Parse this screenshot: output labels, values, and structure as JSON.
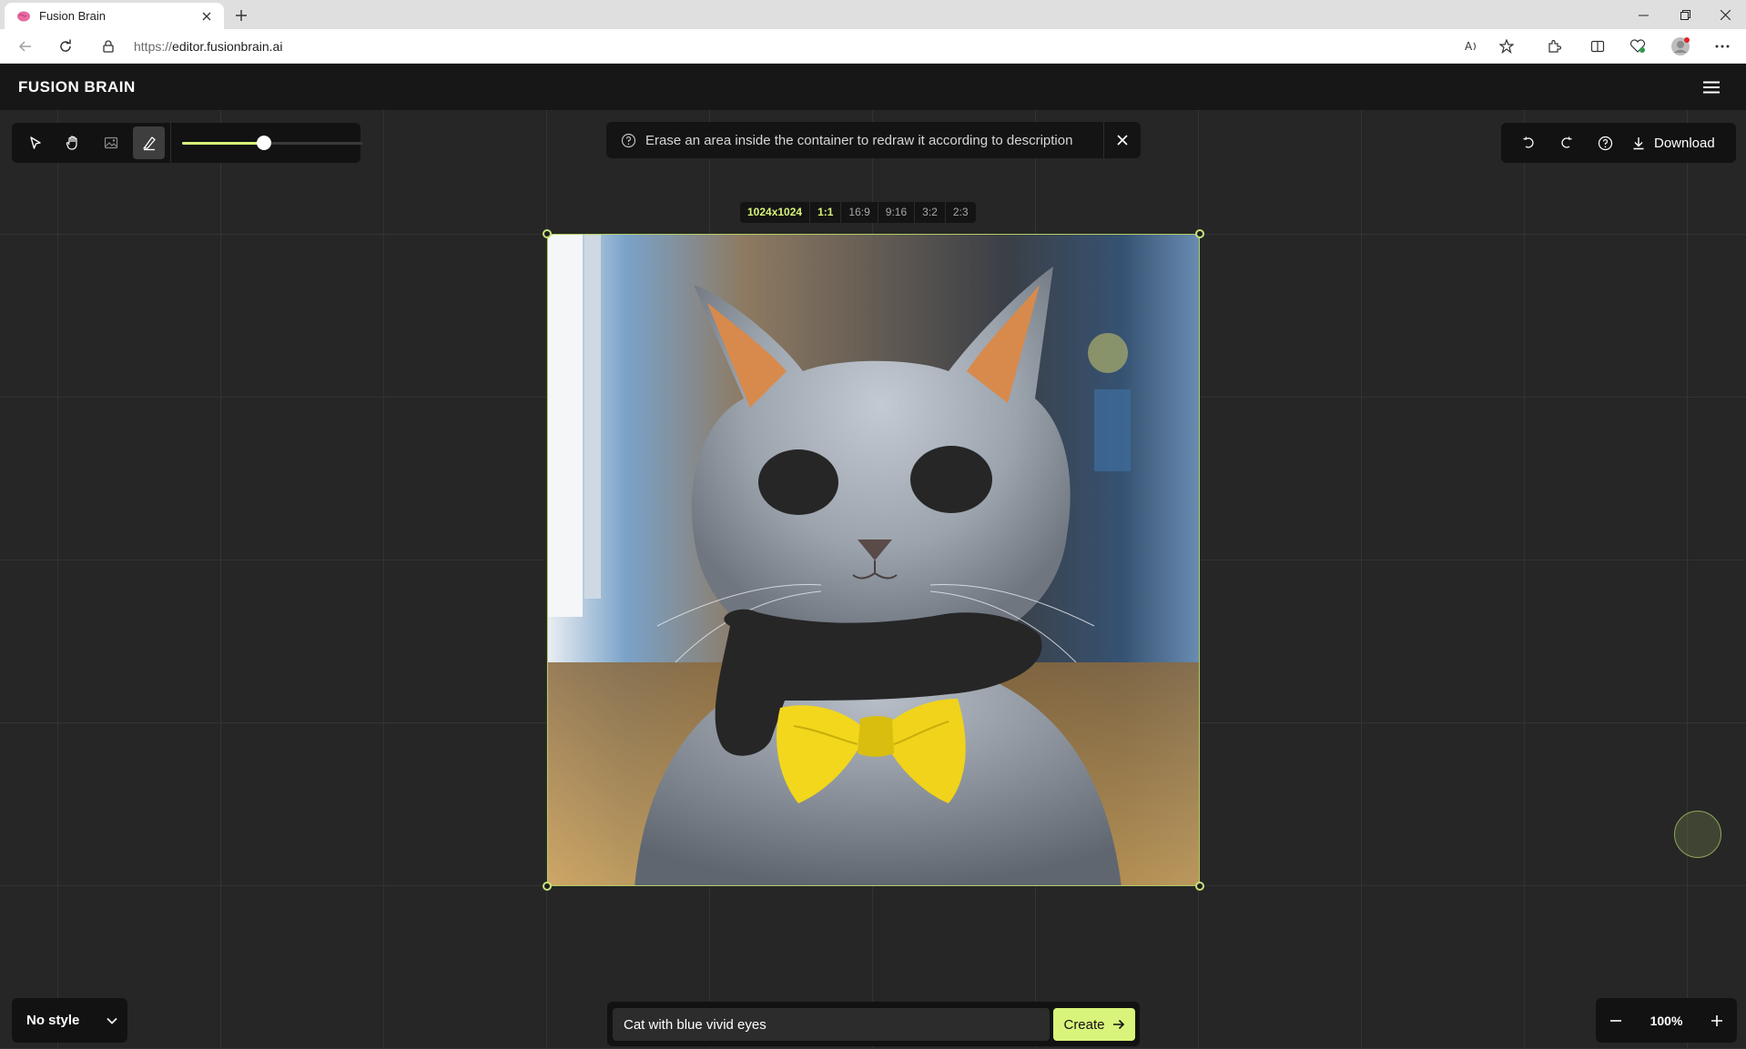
{
  "browser": {
    "tab_title": "Fusion Brain",
    "url_scheme": "https://",
    "url_host": "editor.fusionbrain.ai"
  },
  "app": {
    "logo": "FUSION BRAIN"
  },
  "toolbar": {
    "tools": [
      "select-tool",
      "pan-tool",
      "image-tool",
      "eraser-tool"
    ],
    "active_tool": "eraser-tool",
    "brush_size": 0.46
  },
  "hint": {
    "text": "Erase an area inside the container to redraw it according to description"
  },
  "actions": {
    "download_label": "Download"
  },
  "ratios": {
    "resolution": "1024x1024",
    "options": [
      "1:1",
      "16:9",
      "9:16",
      "3:2",
      "2:3"
    ],
    "selected": "1:1"
  },
  "style": {
    "selected": "No style"
  },
  "prompt": {
    "value": "Cat with blue vivid eyes",
    "create_label": "Create"
  },
  "zoom": {
    "value": "100%"
  },
  "colors": {
    "accent": "#d8f47a",
    "bowtie": "#f2d71c",
    "erased": "#262626"
  }
}
